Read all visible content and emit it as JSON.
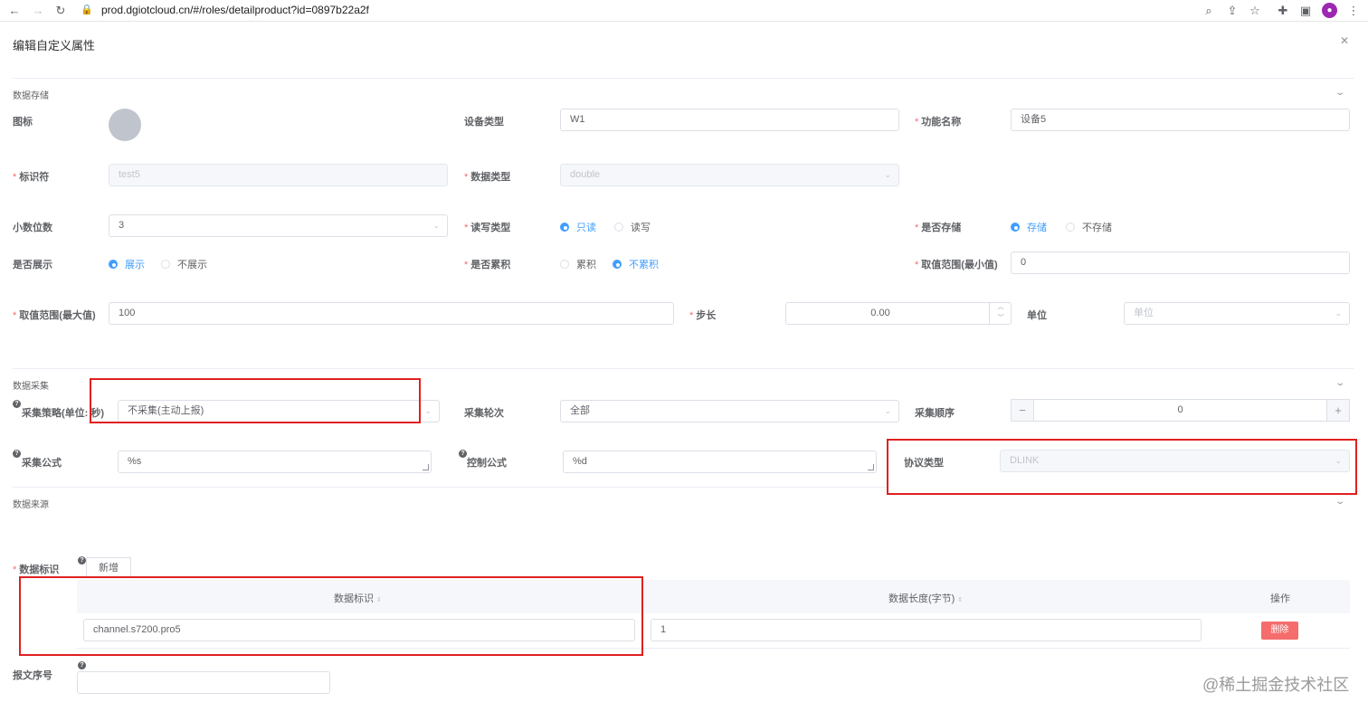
{
  "browser": {
    "url": "prod.dgiotcloud.cn/#/roles/detailproduct?id=0897b22a2f"
  },
  "dialog": {
    "title": "编辑自定义属性",
    "close_icon": "close-icon"
  },
  "sections": {
    "storage": "数据存储",
    "collect": "数据采集",
    "source": "数据来源"
  },
  "storage": {
    "icon_label": "图标",
    "device_type_label": "设备类型",
    "device_type_value": "W1",
    "func_name_label": "功能名称",
    "func_name_value": "设备5",
    "identifier_label": "标识符",
    "identifier_value": "test5",
    "data_type_label": "数据类型",
    "data_type_value": "double",
    "decimals_label": "小数位数",
    "decimals_value": "3",
    "rw_label": "读写类型",
    "rw_options": [
      "只读",
      "读写"
    ],
    "rw_selected": "只读",
    "store_label": "是否存储",
    "store_options": [
      "存储",
      "不存储"
    ],
    "store_selected": "存储",
    "show_label": "是否展示",
    "show_options": [
      "展示",
      "不展示"
    ],
    "show_selected": "展示",
    "accum_label": "是否累积",
    "accum_options": [
      "累积",
      "不累积"
    ],
    "accum_selected": "不累积",
    "min_label": "取值范围(最小值)",
    "min_value": "0",
    "max_label": "取值范围(最大值)",
    "max_value": "100",
    "step_label": "步长",
    "step_value": "0.00",
    "unit_label": "单位",
    "unit_placeholder": "单位"
  },
  "collect": {
    "strategy_label": "采集策略(单位: 秒)",
    "strategy_value": "不采集(主动上报)",
    "round_label": "采集轮次",
    "round_value": "全部",
    "order_label": "采集顺序",
    "order_value": "0",
    "formula_label": "采集公式",
    "formula_value": "%s",
    "control_label": "控制公式",
    "control_value": "%d",
    "protocol_label": "协议类型",
    "protocol_value": "DLINK"
  },
  "source": {
    "data_id_label": "数据标识",
    "add_button": "新增",
    "table_headers": [
      "数据标识",
      "数据长度(字节)",
      "操作"
    ],
    "rows": [
      {
        "id": "channel.s7200.pro5",
        "length": "1",
        "action": "删除"
      }
    ],
    "seq_label": "报文序号"
  },
  "watermark": "@稀土掘金技术社区"
}
